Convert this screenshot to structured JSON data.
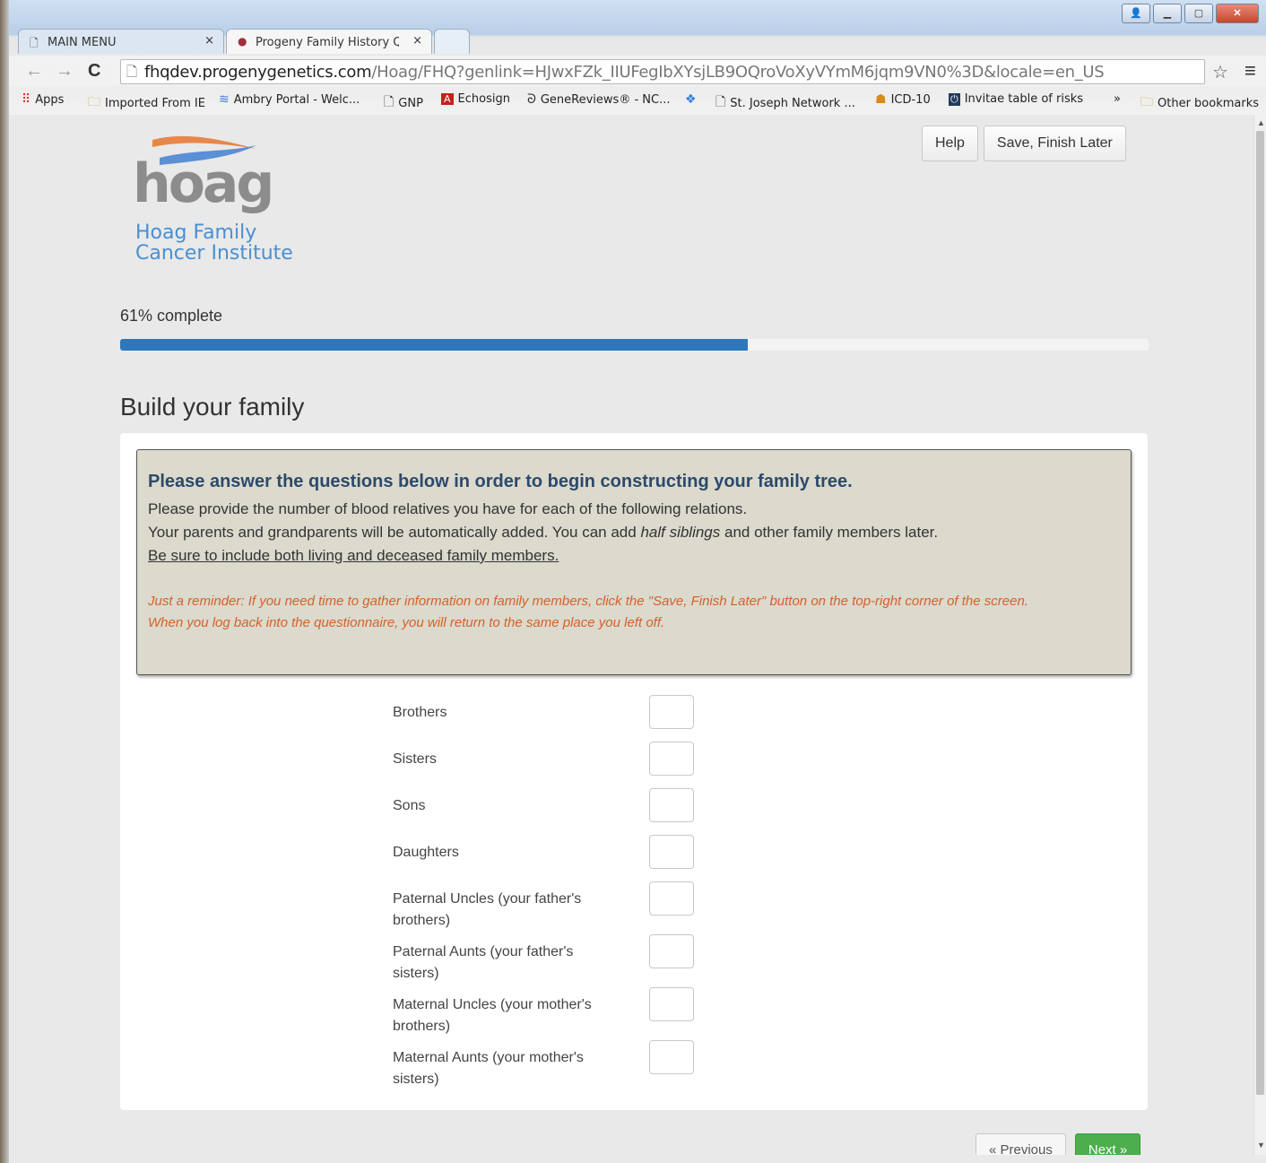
{
  "browser": {
    "tabs": [
      {
        "label": "MAIN MENU",
        "close": "×"
      },
      {
        "label": "Progeny Family History Qu",
        "close": "×"
      }
    ],
    "url": {
      "host": "fhqdev.progenygenetics.com",
      "rest": "/Hoag/FHQ?genlink=HJwxFZk_IIUFegIbXYsjLB9OQroVoXyVYmM6jqm9VN0%3D&locale=en_US"
    },
    "bookmarks": [
      {
        "label": "Apps",
        "icon": "apps-grid-icon"
      },
      {
        "label": "Imported From IE",
        "icon": "folder-icon"
      },
      {
        "label": "Ambry Portal - Welc...",
        "icon": "ambry-icon"
      },
      {
        "label": "GNP",
        "icon": "page-icon"
      },
      {
        "label": "Echosign",
        "icon": "adobe-icon"
      },
      {
        "label": "GeneReviews® - NC...",
        "icon": "dna-icon"
      },
      {
        "label": "",
        "icon": "dropbox-icon"
      },
      {
        "label": "St. Joseph Network ...",
        "icon": "page-icon"
      },
      {
        "label": "ICD-10",
        "icon": "people-icon"
      },
      {
        "label": "Invitae table of risks",
        "icon": "power-icon"
      },
      {
        "label": "»",
        "icon": ""
      },
      {
        "label": "Other bookmarks",
        "icon": "folder-icon"
      }
    ]
  },
  "header": {
    "logo_word": "hoag",
    "logo_sub_1": "Hoag Family",
    "logo_sub_2": "Cancer Institute",
    "help_label": "Help",
    "save_label": "Save, Finish Later"
  },
  "progress": {
    "label": "61% complete",
    "fraction": 0.61
  },
  "section_title": "Build your family",
  "notice": {
    "heading": "Please answer the questions below in order to begin constructing your family tree.",
    "line1": "Please provide the number of blood relatives you have for each of the following relations.",
    "line2_pre": "Your parents and grandparents will be automatically added. You can add ",
    "line2_em": "half siblings",
    "line2_post": " and other family members later.",
    "line3": "Be sure to include both living and deceased family members.",
    "reminder1": "Just a reminder: If you need time to gather information on family members, click the \"Save, Finish Later\" button on the top-right corner of the screen.",
    "reminder2": "When you log back into the questionnaire, you will return to the same place you left off."
  },
  "relations": [
    {
      "label": "Brothers",
      "value": ""
    },
    {
      "label": "Sisters",
      "value": ""
    },
    {
      "label": "Sons",
      "value": ""
    },
    {
      "label": "Daughters",
      "value": ""
    },
    {
      "label": "Paternal Uncles (your father's brothers)",
      "value": ""
    },
    {
      "label": "Paternal Aunts (your father's sisters)",
      "value": ""
    },
    {
      "label": "Maternal Uncles (your mother's brothers)",
      "value": ""
    },
    {
      "label": "Maternal Aunts (your mother's sisters)",
      "value": ""
    }
  ],
  "footer": {
    "previous_label": "« Previous",
    "next_label": "Next »"
  },
  "colors": {
    "progress": "#2f77bb",
    "notice_heading": "#2b4a6b",
    "reminder": "#d4612a",
    "next_button": "#4cae4c",
    "logo_blue": "#4a8fd1"
  }
}
